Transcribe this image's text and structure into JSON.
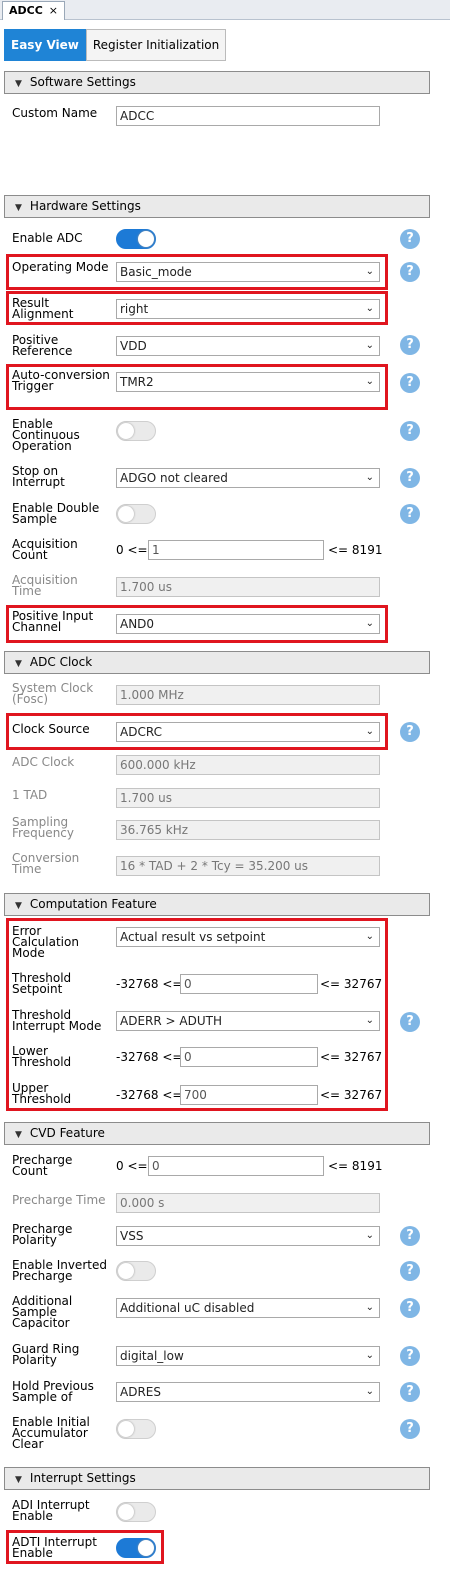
{
  "tab": {
    "title": "ADCC",
    "close": "×"
  },
  "subtabs": [
    "Easy View",
    "Register Initialization"
  ],
  "sections": {
    "software": "Software Settings",
    "hardware": "Hardware Settings",
    "clock": "ADC Clock",
    "comp": "Computation Feature",
    "cvd": "CVD Feature",
    "interrupt": "Interrupt Settings"
  },
  "software": {
    "custom_name_label": "Custom Name",
    "custom_name_value": "ADCC"
  },
  "hardware": {
    "enable_adc": "Enable ADC",
    "op_mode_label": "Operating Mode",
    "op_mode_value": "Basic_mode",
    "result_align_label": "Result Alignment",
    "result_align_value": "right",
    "pos_ref_label": "Positive Reference",
    "pos_ref_value": "VDD",
    "auto_trig_label": "Auto-conversion Trigger",
    "auto_trig_value": "TMR2",
    "cont_op_label": "Enable Continuous Operation",
    "stop_label": "Stop on Interrupt",
    "stop_value": "ADGO not cleared",
    "double_label": "Enable Double Sample",
    "acq_count_label": "Acquisition Count",
    "acq_count_min": "0 <=",
    "acq_count_value": "1",
    "acq_count_max": "<= 8191",
    "acq_time_label": "Acquisition Time",
    "acq_time_value": "1.700 us",
    "pos_in_label": "Positive Input Channel",
    "pos_in_value": "AND0"
  },
  "clock": {
    "sys_label": "System Clock (Fosc)",
    "sys_value": "1.000 MHz",
    "src_label": "Clock Source",
    "src_value": "ADCRC",
    "adc_label": "ADC Clock",
    "adc_value": "600.000 kHz",
    "tad_label": "1 TAD",
    "tad_value": "1.700 us",
    "samp_label": "Sampling Frequency",
    "samp_value": "36.765 kHz",
    "conv_label": "Conversion Time",
    "conv_value": "16 * TAD + 2 * Tcy = 35.200 us"
  },
  "comp": {
    "err_label": "Error Calculation Mode",
    "err_value": "Actual result vs setpoint",
    "thr_sp_label": "Threshold Setpoint",
    "thr_sp_min": "-32768 <=",
    "thr_sp_value": "0",
    "thr_sp_max": "<= 32767",
    "thr_int_label": "Threshold Interrupt Mode",
    "thr_int_value": "ADERR > ADUTH",
    "low_label": "Lower Threshold",
    "low_min": "-32768 <=",
    "low_value": "0",
    "low_max": "<= 32767",
    "up_label": "Upper Threshold",
    "up_min": "-32768 <=",
    "up_value": "700",
    "up_max": "<= 32767"
  },
  "cvd": {
    "pc_count_label": "Precharge Count",
    "pc_count_min": "0 <=",
    "pc_count_value": "0",
    "pc_count_max": "<= 8191",
    "pc_time_label": "Precharge Time",
    "pc_time_value": "0.000 s",
    "pc_pol_label": "Precharge Polarity",
    "pc_pol_value": "VSS",
    "inv_label": "Enable Inverted Precharge",
    "add_cap_label": "Additional Sample Capacitor",
    "add_cap_value": "Additional uC disabled",
    "guard_label": "Guard Ring Polarity",
    "guard_value": "digital_low",
    "hold_label": "Hold Previous Sample of",
    "hold_value": "ADRES",
    "init_acc_label": "Enable Initial Accumulator Clear"
  },
  "interrupt": {
    "adi_label": "ADI Interrupt Enable",
    "adti_label": "ADTI Interrupt Enable"
  },
  "help_glyph": "?",
  "dropdown_glyph": "⌄",
  "section_glyph": "▼",
  "colors": {
    "accent": "#1f84d6",
    "highlight": "#e0151f",
    "help": "#7fb6e5"
  }
}
